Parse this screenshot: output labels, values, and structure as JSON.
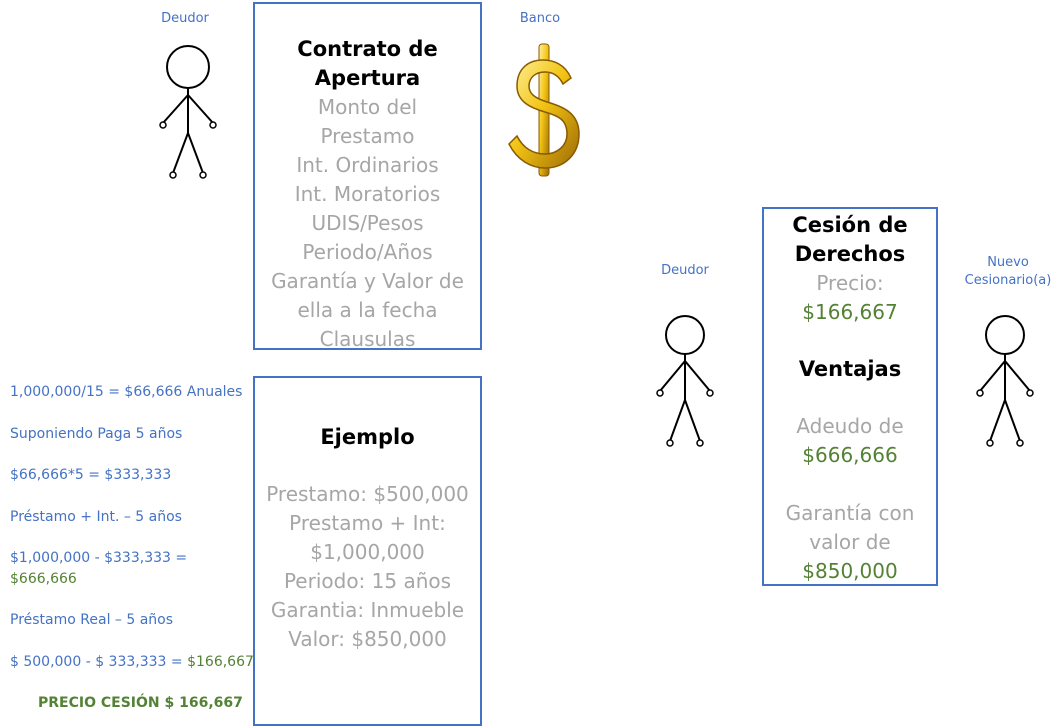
{
  "actors": {
    "debtor_top": "Deudor",
    "bank": "Banco",
    "debtor_right": "Deudor",
    "new_assignee_line1": "Nuevo",
    "new_assignee_line2": "Cesionario(a)"
  },
  "contract_box": {
    "title": "Contrato de Apertura",
    "items": [
      "Monto del",
      "Prestamo",
      "Int. Ordinarios",
      "Int. Moratorios",
      "UDIS/Pesos",
      "Periodo/Años",
      "Garantía y Valor de",
      "ella a la fecha",
      "Clausulas"
    ]
  },
  "example_box": {
    "title": "Ejemplo",
    "items": [
      "Prestamo: $500,000",
      "Prestamo + Int:",
      "$1,000,000",
      "Periodo: 15 años",
      "Garantia: Inmueble",
      "Valor: $850,000"
    ]
  },
  "assignment_box": {
    "title_line1": "Cesión de",
    "title_line2": "Derechos",
    "price_label": "Precio:",
    "price_value": "$166,667",
    "advantages_title": "Ventajas",
    "debt_label": "Adeudo de",
    "debt_value": "$666,666",
    "guarantee_label_line1": "Garantía con",
    "guarantee_label_line2": "valor de",
    "guarantee_value": "$850,000"
  },
  "calculations": {
    "line1": "1,000,000/15 = $66,666  Anuales",
    "line2": "Suponiendo Paga 5 años",
    "line3": "$66,666*5 = $333,333",
    "line4": "Préstamo + Int. – 5 años",
    "line5a": "$1,000,000 - $333,333 =",
    "line5b": "$666,666",
    "line6": "Préstamo Real – 5 años",
    "line7a": "$ 500,000 - $ 333,333 = ",
    "line7b": "$166,667",
    "final": "PRECIO CESIÓN $ 166,667"
  },
  "colors": {
    "accent_blue": "#4472C4",
    "gray_text": "#A6A6A6",
    "green_value": "#548235",
    "dollar_gold": "#E8B30E"
  },
  "icons": [
    "stick-figure-icon",
    "dollar-sign-icon"
  ]
}
